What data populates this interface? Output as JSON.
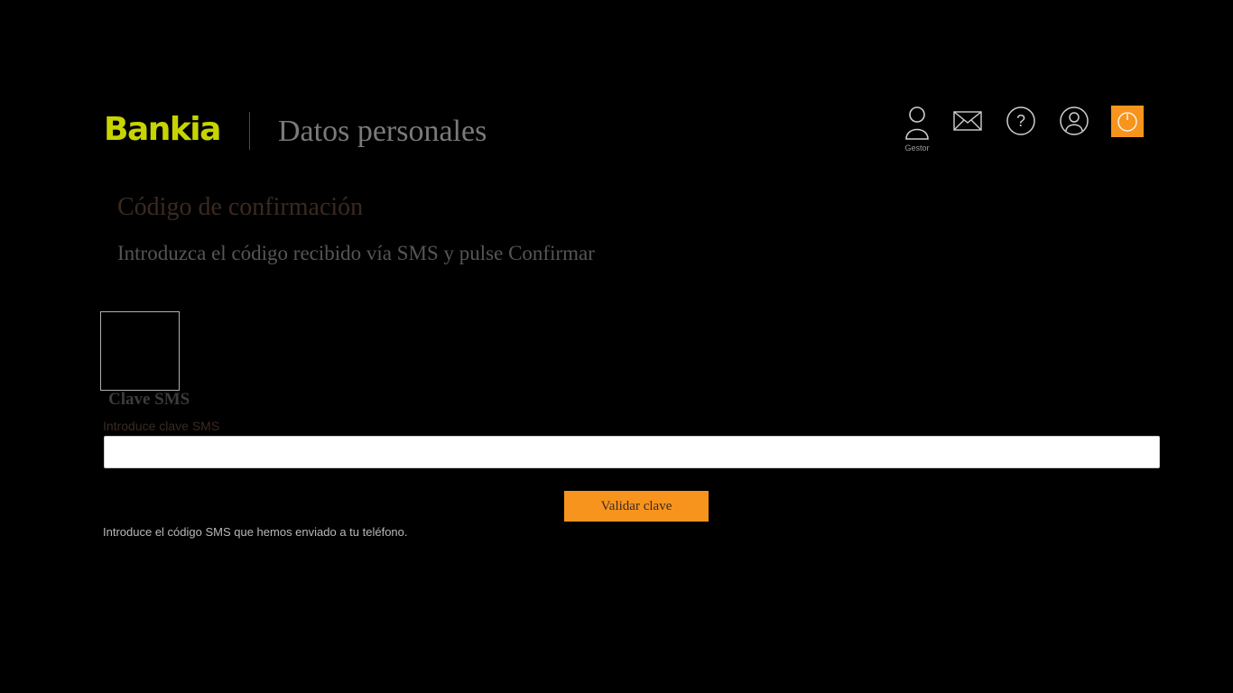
{
  "header": {
    "logo_text": "Bankia",
    "page_title": "Datos personales",
    "gestor_label": "Gestor"
  },
  "icons": {
    "gestor": "gestor-icon",
    "mail": "mail-icon",
    "help": "help-icon",
    "user": "user-icon",
    "power": "power-icon"
  },
  "content": {
    "section_title": "Código de confirmación",
    "section_subtitle": "Introduzca el código recibido vía SMS y pulse Confirmar",
    "clave_label": "Clave SMS",
    "field_label": "Introduce clave SMS",
    "input_value": "",
    "button_label": "Validar clave",
    "help_text": "Introduce el código SMS que hemos enviado a tu teléfono."
  },
  "colors": {
    "background": "#000000",
    "brand_green": "#c8d400",
    "accent_orange": "#f7941d"
  }
}
